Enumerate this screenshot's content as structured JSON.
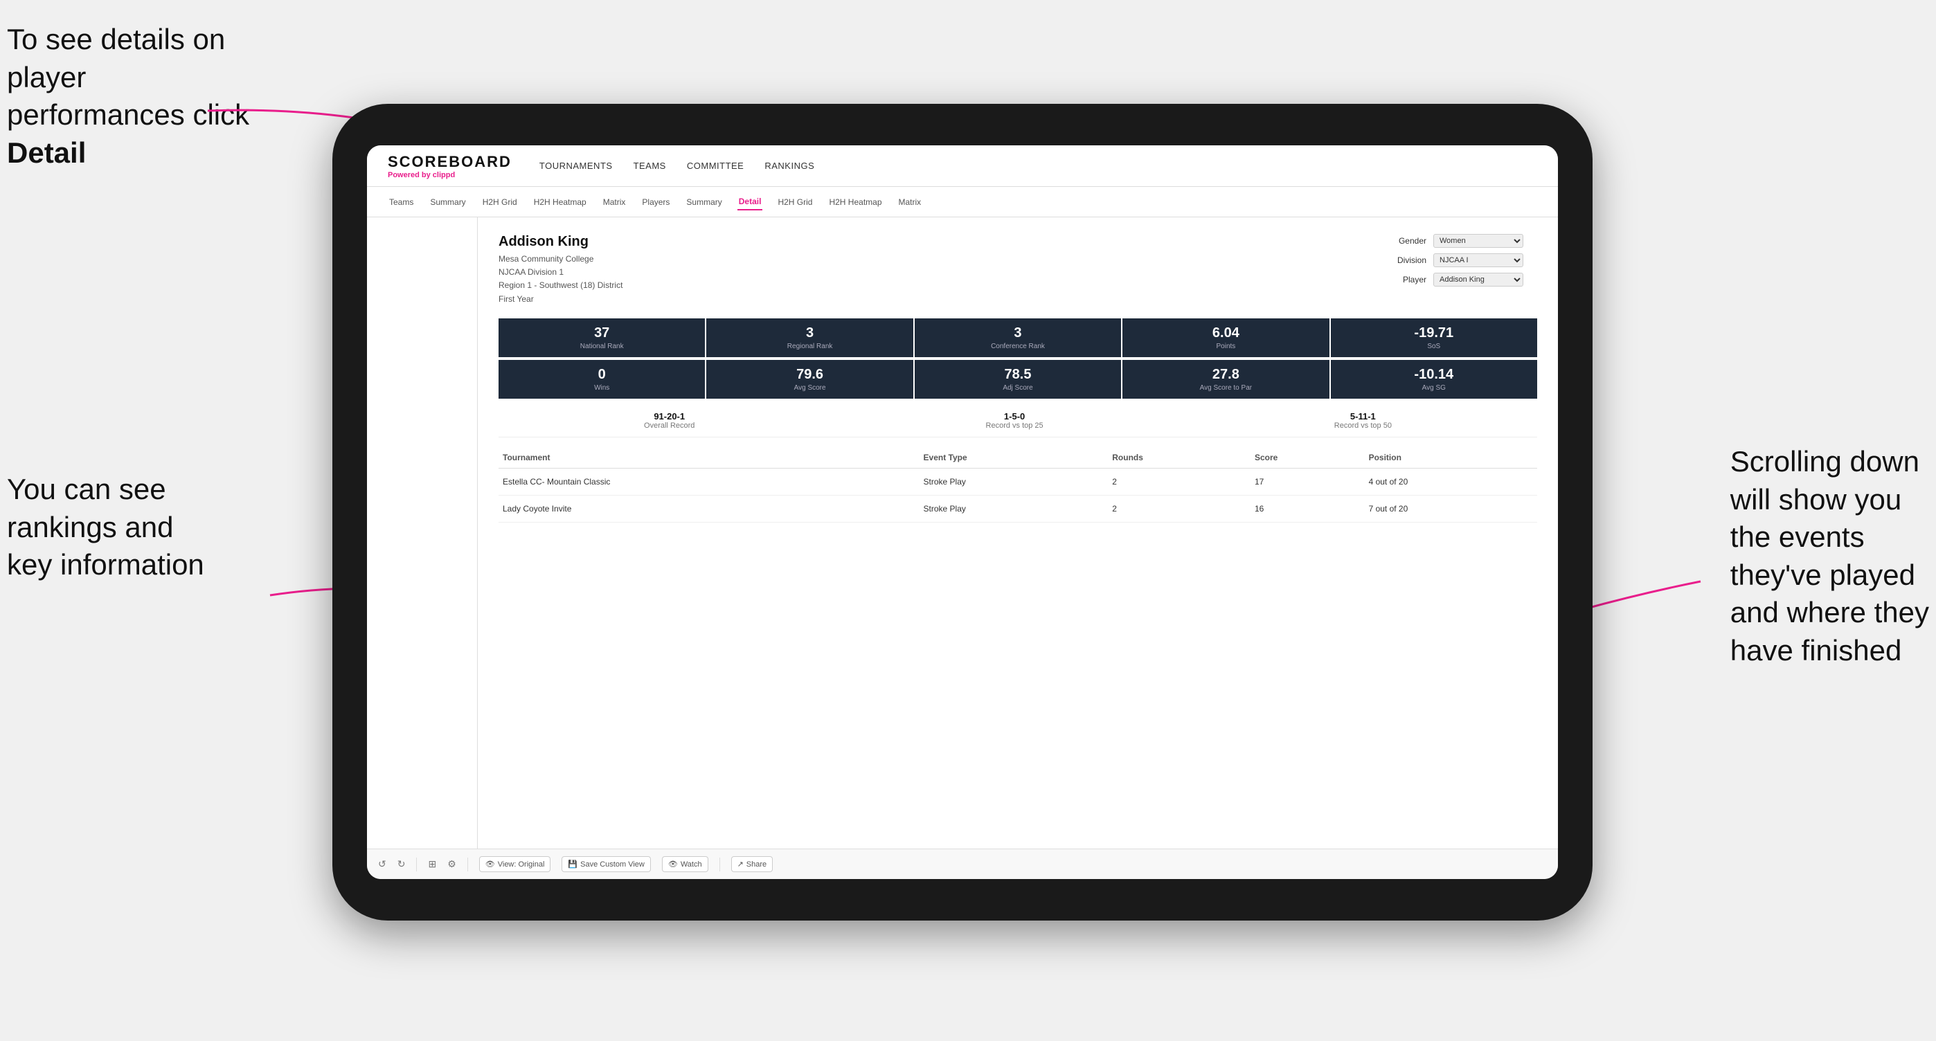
{
  "annotations": {
    "top_left": "To see details on player performances click ",
    "top_left_bold": "Detail",
    "bottom_left_line1": "You can see",
    "bottom_left_line2": "rankings and",
    "bottom_left_line3": "key information",
    "right_line1": "Scrolling down",
    "right_line2": "will show you",
    "right_line3": "the events",
    "right_line4": "they've played",
    "right_line5": "and where they",
    "right_line6": "have finished"
  },
  "logo": {
    "scoreboard": "SCOREBOARD",
    "powered": "Powered by ",
    "brand": "clippd"
  },
  "main_nav": {
    "items": [
      "TOURNAMENTS",
      "TEAMS",
      "COMMITTEE",
      "RANKINGS"
    ]
  },
  "sub_nav": {
    "items": [
      "Teams",
      "Summary",
      "H2H Grid",
      "H2H Heatmap",
      "Matrix",
      "Players",
      "Summary",
      "Detail",
      "H2H Grid",
      "H2H Heatmap",
      "Matrix"
    ],
    "active": "Detail"
  },
  "player": {
    "name": "Addison King",
    "college": "Mesa Community College",
    "division": "NJCAA Division 1",
    "region": "Region 1 - Southwest (18) District",
    "year": "First Year"
  },
  "controls": {
    "gender_label": "Gender",
    "gender_value": "Women",
    "division_label": "Division",
    "division_value": "NJCAA I",
    "player_label": "Player",
    "player_value": "Addison King"
  },
  "stats_row1": [
    {
      "value": "37",
      "label": "National Rank"
    },
    {
      "value": "3",
      "label": "Regional Rank"
    },
    {
      "value": "3",
      "label": "Conference Rank"
    },
    {
      "value": "6.04",
      "label": "Points"
    },
    {
      "value": "-19.71",
      "label": "SoS"
    }
  ],
  "stats_row2": [
    {
      "value": "0",
      "label": "Wins"
    },
    {
      "value": "79.6",
      "label": "Avg Score"
    },
    {
      "value": "78.5",
      "label": "Adj Score"
    },
    {
      "value": "27.8",
      "label": "Avg Score to Par"
    },
    {
      "value": "-10.14",
      "label": "Avg SG"
    }
  ],
  "records": [
    {
      "value": "91-20-1",
      "label": "Overall Record"
    },
    {
      "value": "1-5-0",
      "label": "Record vs top 25"
    },
    {
      "value": "5-11-1",
      "label": "Record vs top 50"
    }
  ],
  "table": {
    "headers": [
      "Tournament",
      "Event Type",
      "Rounds",
      "Score",
      "Position"
    ],
    "rows": [
      {
        "tournament": "Estella CC- Mountain Classic",
        "event_type": "Stroke Play",
        "rounds": "2",
        "score": "17",
        "position": "4 out of 20"
      },
      {
        "tournament": "Lady Coyote Invite",
        "event_type": "Stroke Play",
        "rounds": "2",
        "score": "16",
        "position": "7 out of 20"
      }
    ]
  },
  "toolbar": {
    "undo": "↺",
    "redo": "↻",
    "view_original": "View: Original",
    "save_custom": "Save Custom View",
    "watch": "Watch",
    "share": "Share"
  }
}
